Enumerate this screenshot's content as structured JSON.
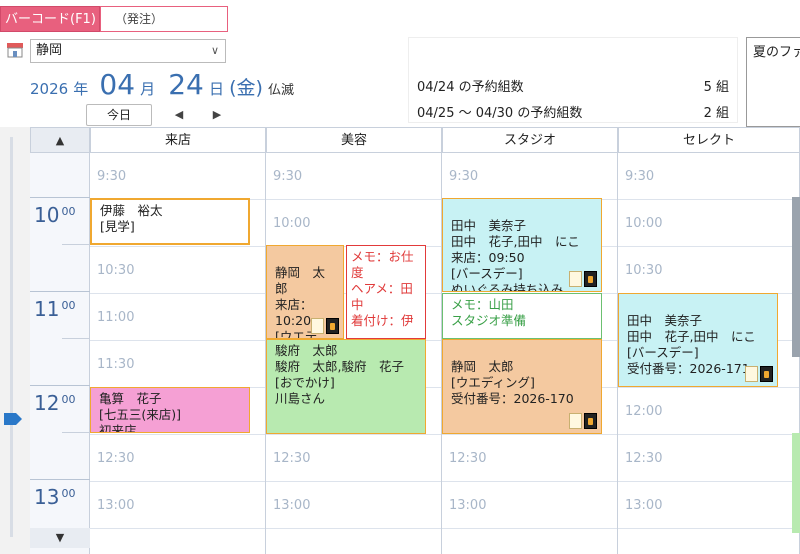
{
  "toolbar": {
    "barcode_label": "バーコード(F1)",
    "order_button": "（発注）"
  },
  "store": {
    "icon": "shop-icon",
    "selected": "静岡",
    "chevron": "chevron-down-icon"
  },
  "date": {
    "year": "2026",
    "year_unit": "年",
    "month": "04",
    "month_unit": "月",
    "day": "24",
    "day_unit": "日",
    "weekday": "(金)",
    "rokuyo": "仏滅"
  },
  "nav": {
    "today": "今日",
    "prev": "◀",
    "next": "▶"
  },
  "summary": {
    "rows": [
      {
        "label": "04/24  の予約組数",
        "count": "5 組"
      },
      {
        "label": "04/25 ～ 04/30 の予約組数",
        "count": "2 組"
      }
    ]
  },
  "notice": {
    "text": "夏のファ"
  },
  "schedule": {
    "up": "▲",
    "down": "▼",
    "columns": [
      "来店",
      "美容",
      "スタジオ",
      "セレクト"
    ],
    "hours": [
      {
        "hour": "10",
        "min": "00"
      },
      {
        "hour": "11",
        "min": "00"
      },
      {
        "hour": "12",
        "min": "00"
      },
      {
        "hour": "13",
        "min": "00"
      }
    ],
    "slot_labels": [
      "9:30",
      "10:00",
      "10:30",
      "11:00",
      "11:30",
      "12:00",
      "12:30",
      "13:00"
    ],
    "events": {
      "raikan_1": "伊藤　裕太\n[見学]",
      "raikan_2": "亀算　花子\n[七五三(来店)]\n初来店",
      "biyou_1": "静岡　太\n郎\n来店：\n10:20\n[ウエデ",
      "biyou_memo": "メモ：お仕\n度\nヘアメ：田\n中\n着付け：伊",
      "biyou_2": "駿府　太郎\n駿府　太郎,駿府　花子\n[おでかけ]\n川島さん",
      "studio_1": "田中　美奈子\n田中　花子,田中　にこ\n来店：09:50\n[バースデー]\nぬいぐるみ持ち込み",
      "studio_memo": "メモ：山田\nスタジオ準備",
      "studio_2": "静岡　太郎\n[ウエディング]\n受付番号：2026-170",
      "select_1": "田中　美奈子\n田中　花子,田中　にこ\n[バースデー]\n受付番号：2026-171"
    }
  }
}
